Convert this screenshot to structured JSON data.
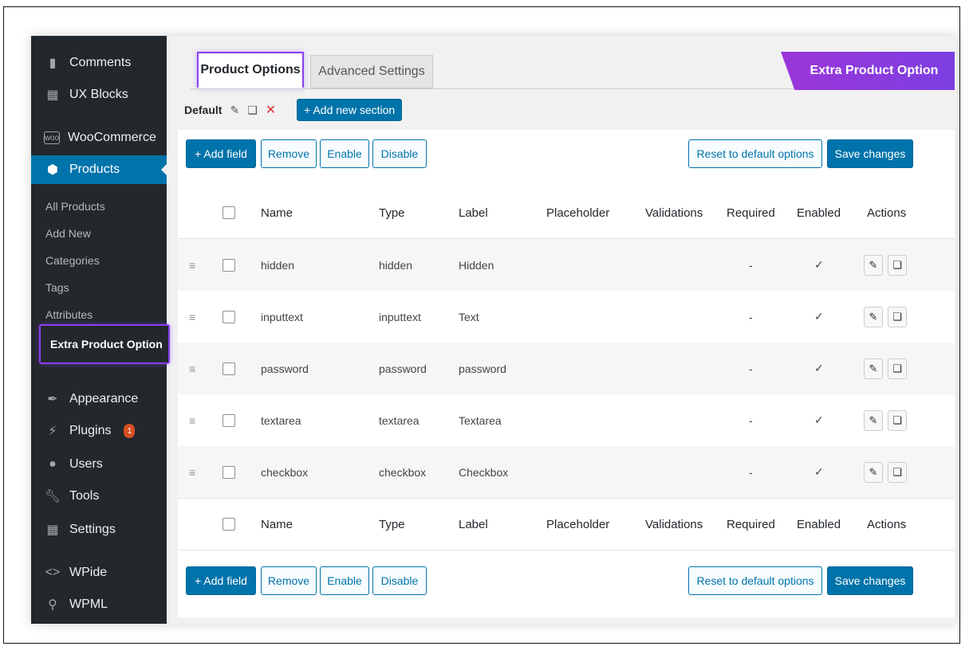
{
  "sidebar": {
    "items": [
      {
        "label": "Comments",
        "icon": "comment-icon"
      },
      {
        "label": "UX Blocks",
        "icon": "blocks-icon"
      },
      {
        "label": "WooCommerce",
        "icon": "woocommerce-icon"
      },
      {
        "label": "Products",
        "icon": "box-icon"
      },
      {
        "label": "Appearance",
        "icon": "brush-icon"
      },
      {
        "label": "Plugins",
        "icon": "plug-icon"
      },
      {
        "label": "Users",
        "icon": "user-icon"
      },
      {
        "label": "Tools",
        "icon": "wrench-icon"
      },
      {
        "label": "Settings",
        "icon": "sliders-icon"
      },
      {
        "label": "WPide",
        "icon": "code-icon"
      },
      {
        "label": "WPML",
        "icon": "wpml-icon"
      }
    ],
    "plugins_badge": "1",
    "submenu": [
      "All Products",
      "Add New",
      "Categories",
      "Tags",
      "Attributes",
      "Extra Product Option"
    ]
  },
  "tabs": {
    "active": "Product Options",
    "inactive": "Advanced Settings"
  },
  "brand": "Extra Product Option",
  "section": {
    "name": "Default",
    "add_section": "+ Add new section"
  },
  "toolbar": {
    "add_field": "+ Add field",
    "remove": "Remove",
    "enable": "Enable",
    "disable": "Disable",
    "reset": "Reset to default options",
    "save": "Save changes"
  },
  "columns": [
    "Name",
    "Type",
    "Label",
    "Placeholder",
    "Validations",
    "Required",
    "Enabled",
    "Actions"
  ],
  "rows": [
    {
      "name": "hidden",
      "type": "hidden",
      "label": "Hidden",
      "placeholder": "",
      "validations": "",
      "required": "-",
      "enabled": "✓"
    },
    {
      "name": "inputtext",
      "type": "inputtext",
      "label": "Text",
      "placeholder": "",
      "validations": "",
      "required": "-",
      "enabled": "✓"
    },
    {
      "name": "password",
      "type": "password",
      "label": "password",
      "placeholder": "",
      "validations": "",
      "required": "-",
      "enabled": "✓"
    },
    {
      "name": "textarea",
      "type": "textarea",
      "label": "Textarea",
      "placeholder": "",
      "validations": "",
      "required": "-",
      "enabled": "✓"
    },
    {
      "name": "checkbox",
      "type": "checkbox",
      "label": "Checkbox",
      "placeholder": "",
      "validations": "",
      "required": "-",
      "enabled": "✓"
    }
  ],
  "colors": {
    "sidebar_bg": "#23282d",
    "wp_blue": "#0073aa",
    "accent_purple": "#8a3ff2",
    "danger": "#dc3232"
  }
}
